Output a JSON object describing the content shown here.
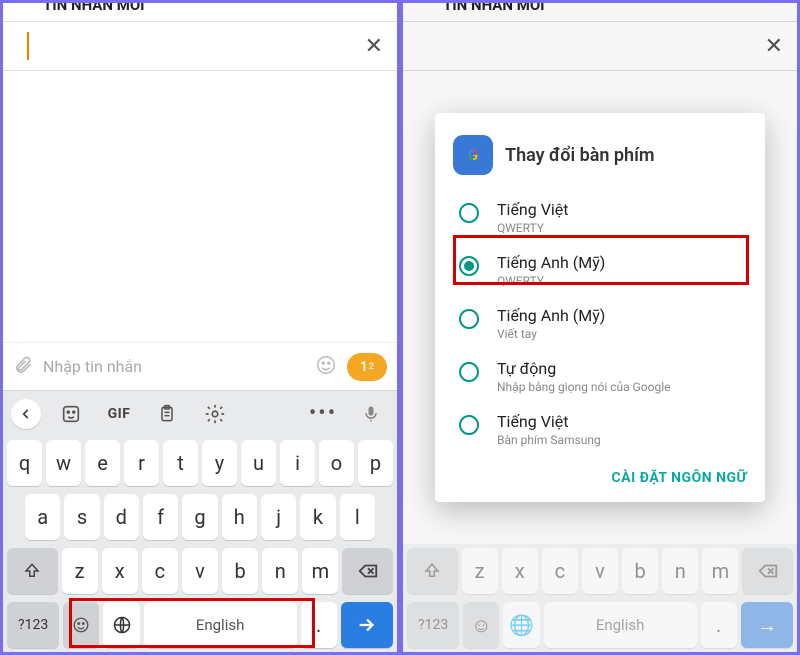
{
  "left": {
    "screen_title": "TIN NHAN MOI",
    "input_placeholder": "Nhập tin nhắn",
    "send_sim": "1",
    "send_sim2": "2",
    "toolbar": {
      "gif": "GIF"
    },
    "rows": {
      "r1": [
        "q",
        "w",
        "e",
        "r",
        "t",
        "y",
        "u",
        "i",
        "o",
        "p"
      ],
      "r2": [
        "a",
        "s",
        "d",
        "f",
        "g",
        "h",
        "j",
        "k",
        "l"
      ],
      "r3": [
        "z",
        "x",
        "c",
        "v",
        "b",
        "n",
        "m"
      ]
    },
    "bottom": {
      "sym": "?123",
      "space": "English",
      "dot": "."
    }
  },
  "right": {
    "screen_title": "TIN NHAN MOI",
    "dialog": {
      "title": "Thay đổi bàn phím",
      "options": [
        {
          "main": "Tiếng Việt",
          "sub": "QWERTY",
          "selected": false
        },
        {
          "main": "Tiếng Anh (Mỹ)",
          "sub": "QWERTY",
          "selected": true
        },
        {
          "main": "Tiếng Anh (Mỹ)",
          "sub": "Viết tay",
          "selected": false
        },
        {
          "main": "Tự động",
          "sub": "Nhập bằng giọng nói của Google",
          "selected": false
        },
        {
          "main": "Tiếng Việt",
          "sub": "Bàn phím Samsung",
          "selected": false
        }
      ],
      "footer": "CÀI ĐẶT NGÔN NGỮ"
    }
  }
}
